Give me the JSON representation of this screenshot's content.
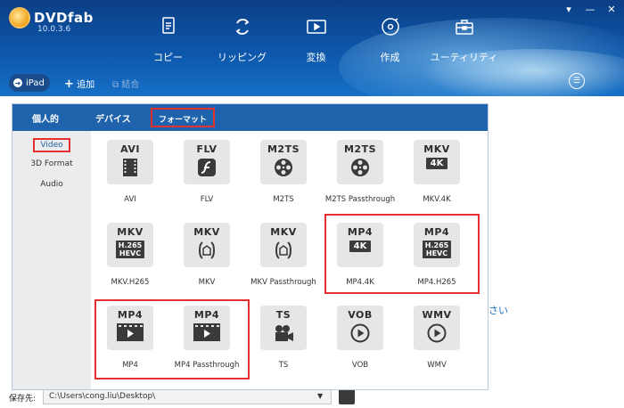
{
  "app": {
    "logo_text": "DVDfab",
    "version": "10.0.3.6",
    "window_controls": [
      "▾",
      "—",
      "✕"
    ]
  },
  "nav": [
    {
      "label": "コピー",
      "icon": "copy-icon"
    },
    {
      "label": "リッピング",
      "icon": "ripper-icon"
    },
    {
      "label": "変換",
      "icon": "converter-icon"
    },
    {
      "label": "作成",
      "icon": "creator-icon"
    },
    {
      "label": "ユーティリティ",
      "icon": "toolbox-icon"
    }
  ],
  "subbar": {
    "device": "iPad",
    "add": "追加",
    "merge": "結合"
  },
  "popup": {
    "tabs": [
      "個人的",
      "デバイス",
      "フォーマット"
    ],
    "active_tab": "フォーマット",
    "sidebar": [
      "Video",
      "3D Format",
      "Audio"
    ],
    "active_sidebar": "Video"
  },
  "formats": [
    {
      "label": "AVI",
      "title": "AVI",
      "icon": "film-strip-icon"
    },
    {
      "label": "FLV",
      "title": "FLV",
      "icon": "flash-icon"
    },
    {
      "label": "M2TS",
      "title": "M2TS",
      "icon": "film-reel-icon"
    },
    {
      "label": "M2TS Passthrough",
      "title": "M2TS",
      "icon": "film-reel-icon"
    },
    {
      "label": "MKV.4K",
      "title": "MKV",
      "badge": "4K",
      "icon": "4k-badge"
    },
    {
      "label": "MKV.H265",
      "title": "MKV",
      "badge": "H.265\nHEVC",
      "icon": "h265-badge"
    },
    {
      "label": "MKV",
      "title": "MKV",
      "icon": "matroska-icon"
    },
    {
      "label": "MKV Passthrough",
      "title": "MKV",
      "icon": "matroska-icon"
    },
    {
      "label": "MP4.4K",
      "title": "MP4",
      "badge": "4K",
      "icon": "4k-badge"
    },
    {
      "label": "MP4.H265",
      "title": "MP4",
      "badge": "H.265\nHEVC",
      "icon": "h265-badge"
    },
    {
      "label": "MP4",
      "title": "MP4",
      "icon": "video-play-icon"
    },
    {
      "label": "MP4 Passthrough",
      "title": "MP4",
      "icon": "video-play-icon"
    },
    {
      "label": "TS",
      "title": "TS",
      "icon": "camera-icon"
    },
    {
      "label": "VOB",
      "title": "VOB",
      "icon": "play-circle-icon"
    },
    {
      "label": "WMV",
      "title": "WMV",
      "icon": "play-circle-icon"
    }
  ],
  "background": {
    "partial_text": "さい",
    "save_label": "保存先:",
    "save_path": "C:\\Users\\cong.liu\\Desktop\\"
  },
  "colors": {
    "banner": "#0d57ab",
    "tab_bar": "#1f63ad",
    "highlight": "#e53030",
    "tile_bg": "#e6e6e6"
  }
}
